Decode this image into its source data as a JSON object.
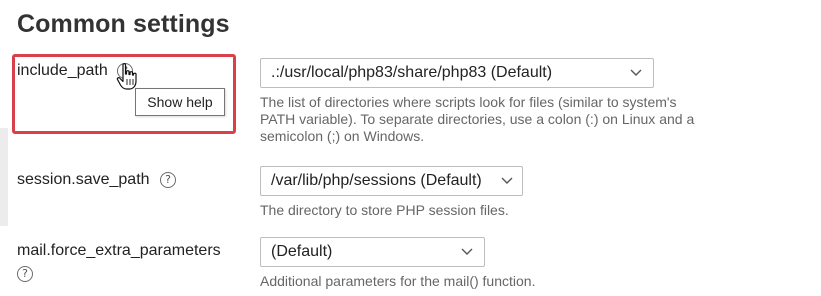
{
  "section": {
    "title": "Common settings"
  },
  "settings": [
    {
      "label": "include_path",
      "value": ".:/usr/local/php83/share/php83 (Default)",
      "description": "The list of directories where scripts look for files (similar to system's PATH variable). To separate directories, use a colon (:) on Linux and a semicolon (;) on Windows."
    },
    {
      "label": "session.save_path",
      "value": "/var/lib/php/sessions (Default)",
      "description": "The directory to store PHP session files."
    },
    {
      "label": "mail.force_extra_parameters",
      "value": "(Default)",
      "description": "Additional parameters for the mail() function."
    }
  ],
  "tooltip": {
    "text": "Show help"
  },
  "help_icon_glyph": "?",
  "colors": {
    "highlight": "#d9414a",
    "description_text": "#666666"
  },
  "icons": {
    "help": "question-circle-icon",
    "dropdown": "chevron-down-icon",
    "cursor": "hand-pointer-cursor"
  }
}
